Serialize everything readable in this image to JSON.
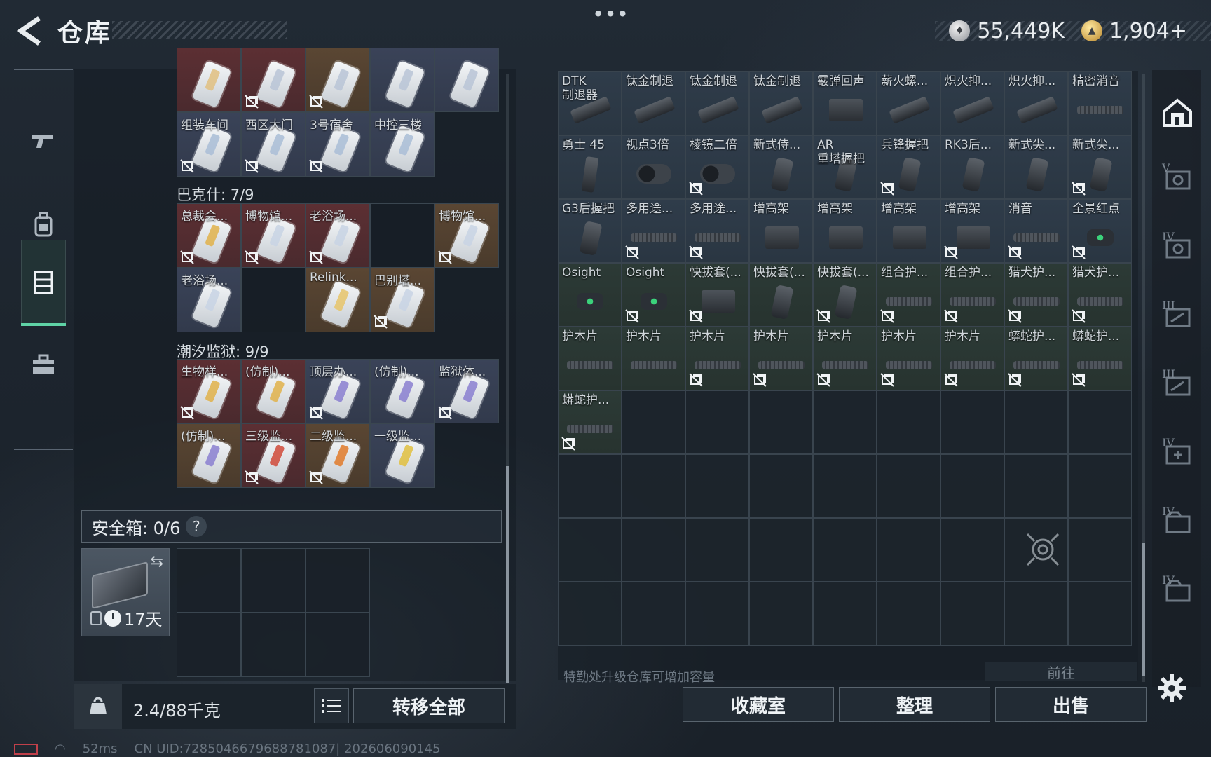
{
  "header": {
    "title": "仓库",
    "silver": "55,449K",
    "gold": "1,904",
    "gold_plus": "+"
  },
  "left": {
    "groups": [
      {
        "label": "",
        "items": [
          {
            "label": "",
            "tone": "red",
            "nolink": false,
            "color": "#e0c080"
          },
          {
            "label": "",
            "tone": "red",
            "nolink": true,
            "color": "#b8c4d6"
          },
          {
            "label": "",
            "tone": "gold",
            "nolink": true,
            "color": "#b8c4d6"
          },
          {
            "label": "",
            "tone": "blue",
            "nolink": false,
            "color": "#b8c4d6"
          },
          {
            "label": "",
            "tone": "blue",
            "nolink": false,
            "color": "#b8c4d6"
          },
          {
            "label": "组装车间",
            "tone": "blue",
            "nolink": true,
            "color": "#a9bdd6"
          },
          {
            "label": "西区大门",
            "tone": "blue",
            "nolink": true,
            "color": "#a9bdd6"
          },
          {
            "label": "3号宿舍",
            "tone": "blue",
            "nolink": true,
            "color": "#a9bdd6"
          },
          {
            "label": "中控三楼",
            "tone": "blue",
            "nolink": false,
            "color": "#a9bdd6"
          }
        ]
      },
      {
        "label": "巴克什: 7/9",
        "items": [
          {
            "label": "总裁会...",
            "tone": "red",
            "nolink": true,
            "color": "#e0b24a"
          },
          {
            "label": "博物馆...",
            "tone": "red",
            "nolink": true,
            "color": "#c8d4e4"
          },
          {
            "label": "老浴场...",
            "tone": "red",
            "nolink": true,
            "color": "#c8d4e4"
          },
          {
            "label": "",
            "tone": "empty",
            "nolink": false,
            "color": ""
          },
          {
            "label": "博物馆...",
            "tone": "gold",
            "nolink": true,
            "color": "#c8d4e4"
          },
          {
            "label": "老浴场...",
            "tone": "blue",
            "nolink": false,
            "color": "#c8d4e4"
          },
          {
            "label": "",
            "tone": "empty",
            "nolink": false,
            "color": ""
          },
          {
            "label": "Relink...",
            "tone": "gold",
            "nolink": false,
            "color": "#e6c46a"
          },
          {
            "label": "巴别塔...",
            "tone": "gold",
            "nolink": true,
            "color": "#c8d4e4"
          }
        ]
      },
      {
        "label": "潮汐监狱: 9/9",
        "items": [
          {
            "label": "生物样...",
            "tone": "red",
            "nolink": true,
            "color": "#e0b24a"
          },
          {
            "label": "(仿制)...",
            "tone": "red",
            "nolink": false,
            "color": "#e0b24a"
          },
          {
            "label": "顶层办...",
            "tone": "blue",
            "nolink": true,
            "color": "#8a7fd0"
          },
          {
            "label": "(仿制)...",
            "tone": "blue",
            "nolink": false,
            "color": "#8a7fd0"
          },
          {
            "label": "监狱体...",
            "tone": "blue",
            "nolink": true,
            "color": "#8a7fd0"
          },
          {
            "label": "(仿制)...",
            "tone": "gold",
            "nolink": false,
            "color": "#8a7fd0"
          },
          {
            "label": "三级监...",
            "tone": "red",
            "nolink": true,
            "color": "#d04a3a"
          },
          {
            "label": "二级监...",
            "tone": "gold",
            "nolink": true,
            "color": "#e07a2a"
          },
          {
            "label": "一级监...",
            "tone": "blue",
            "nolink": false,
            "color": "#e0c040"
          }
        ]
      }
    ],
    "safe_label": "安全箱: 0/6",
    "help": "?",
    "case_days": "17天",
    "weight": "2.4/88千克",
    "move_all": "转移全部"
  },
  "right": {
    "items": [
      {
        "label": "DTK\n制退器",
        "kind": "part",
        "tone": "sil",
        "nolink": false
      },
      {
        "label": "钛金制退",
        "kind": "part",
        "tone": "sil",
        "nolink": false
      },
      {
        "label": "钛金制退",
        "kind": "part",
        "tone": "sil",
        "nolink": false
      },
      {
        "label": "钛金制退",
        "kind": "part",
        "tone": "sil",
        "nolink": false
      },
      {
        "label": "霰弹回声",
        "kind": "box",
        "tone": "sil",
        "nolink": false
      },
      {
        "label": "薪火螺...",
        "kind": "part",
        "tone": "sil",
        "nolink": false
      },
      {
        "label": "炽火抑...",
        "kind": "part",
        "tone": "sil",
        "nolink": false
      },
      {
        "label": "炽火抑...",
        "kind": "part",
        "tone": "sil",
        "nolink": false
      },
      {
        "label": "精密消音",
        "kind": "flat",
        "tone": "sil",
        "nolink": false
      },
      {
        "label": "勇士 45",
        "kind": "mag",
        "tone": "sil",
        "nolink": false
      },
      {
        "label": "视点3倍",
        "kind": "scope",
        "tone": "sil",
        "nolink": false
      },
      {
        "label": "棱镜二倍",
        "kind": "scope",
        "tone": "sil",
        "nolink": true
      },
      {
        "label": "新式侍...",
        "kind": "grip",
        "tone": "sil",
        "nolink": false
      },
      {
        "label": "AR\n重塔握把",
        "kind": "grip",
        "tone": "sil",
        "nolink": false
      },
      {
        "label": "兵锋握把",
        "kind": "grip",
        "tone": "sil",
        "nolink": true
      },
      {
        "label": "RK3后...",
        "kind": "grip",
        "tone": "sil",
        "nolink": false
      },
      {
        "label": "新式尖...",
        "kind": "grip",
        "tone": "sil",
        "nolink": false
      },
      {
        "label": "新式尖...",
        "kind": "grip",
        "tone": "sil",
        "nolink": true
      },
      {
        "label": "G3后握把",
        "kind": "grip",
        "tone": "sil",
        "nolink": false
      },
      {
        "label": "多用途...",
        "kind": "flat",
        "tone": "sil",
        "nolink": true
      },
      {
        "label": "多用途...",
        "kind": "flat",
        "tone": "sil",
        "nolink": true
      },
      {
        "label": "增高架",
        "kind": "box",
        "tone": "sil",
        "nolink": false
      },
      {
        "label": "增高架",
        "kind": "box",
        "tone": "sil",
        "nolink": false
      },
      {
        "label": "增高架",
        "kind": "box",
        "tone": "sil",
        "nolink": false
      },
      {
        "label": "增高架",
        "kind": "box",
        "tone": "sil",
        "nolink": true
      },
      {
        "label": "消音",
        "kind": "flat",
        "tone": "sil",
        "nolink": true
      },
      {
        "label": "全景红点",
        "kind": "opt",
        "tone": "sil",
        "nolink": true
      },
      {
        "label": "Osight",
        "kind": "opt",
        "tone": "grn",
        "nolink": false
      },
      {
        "label": "Osight",
        "kind": "opt",
        "tone": "grn",
        "nolink": true
      },
      {
        "label": "快拔套(...",
        "kind": "box",
        "tone": "grn",
        "nolink": true
      },
      {
        "label": "快拔套(...",
        "kind": "grip",
        "tone": "grn",
        "nolink": false
      },
      {
        "label": "快拔套(...",
        "kind": "grip",
        "tone": "grn",
        "nolink": true
      },
      {
        "label": "组合护...",
        "kind": "flat",
        "tone": "grn",
        "nolink": true
      },
      {
        "label": "组合护...",
        "kind": "flat",
        "tone": "grn",
        "nolink": true
      },
      {
        "label": "猎犬护...",
        "kind": "flat",
        "tone": "grn",
        "nolink": true
      },
      {
        "label": "猎犬护...",
        "kind": "flat",
        "tone": "grn",
        "nolink": true
      },
      {
        "label": "护木片",
        "kind": "flat",
        "tone": "grn",
        "nolink": false
      },
      {
        "label": "护木片",
        "kind": "flat",
        "tone": "grn",
        "nolink": false
      },
      {
        "label": "护木片",
        "kind": "flat",
        "tone": "grn",
        "nolink": true
      },
      {
        "label": "护木片",
        "kind": "flat",
        "tone": "grn",
        "nolink": true
      },
      {
        "label": "护木片",
        "kind": "flat",
        "tone": "grn",
        "nolink": true
      },
      {
        "label": "护木片",
        "kind": "flat",
        "tone": "grn",
        "nolink": true
      },
      {
        "label": "护木片",
        "kind": "flat",
        "tone": "grn",
        "nolink": true
      },
      {
        "label": "蟒蛇护...",
        "kind": "flat",
        "tone": "grn",
        "nolink": true
      },
      {
        "label": "蟒蛇护...",
        "kind": "flat",
        "tone": "grn",
        "nolink": true
      },
      {
        "label": "蟒蛇护...",
        "kind": "flat",
        "tone": "grn",
        "nolink": true
      }
    ],
    "empty_slots": 35,
    "hint": "特勤处升级仓库可增加容量",
    "goto": "前往",
    "buttons": [
      "收藏室",
      "整理",
      "出售"
    ]
  },
  "status": {
    "ping": "52ms",
    "uid": "CN UID:7285046679688781087| 202606090145"
  },
  "right_nav": {
    "levels": [
      "V",
      "IV",
      "III",
      "III",
      "IV",
      "IV",
      "IV"
    ]
  }
}
